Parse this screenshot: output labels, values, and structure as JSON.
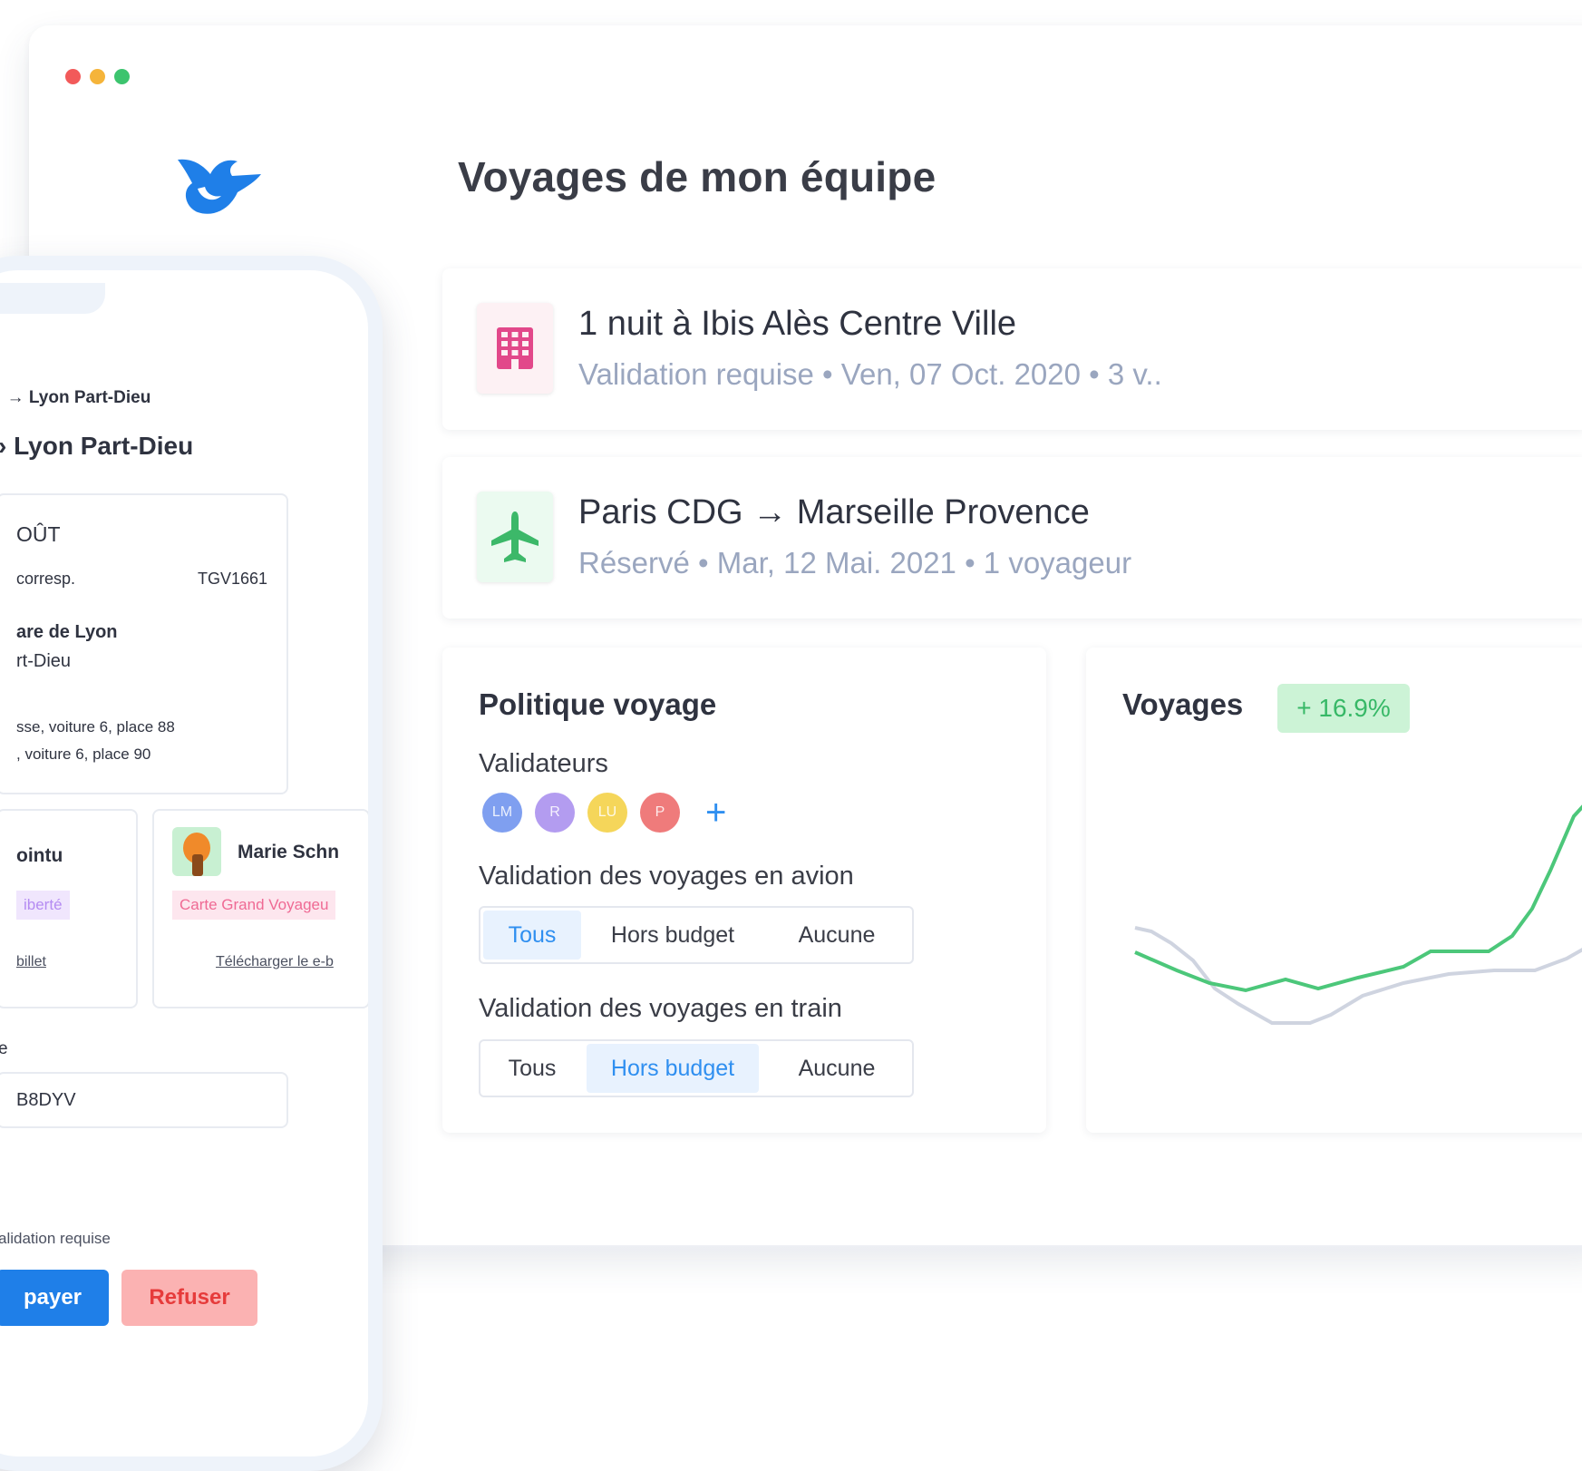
{
  "window_controls": {
    "close_color": "#f25a5a",
    "minimize_color": "#f5b43a",
    "maximize_color": "#3cc46e"
  },
  "header": {
    "title": "Voyages de mon équipe"
  },
  "trips": [
    {
      "title": "1 nuit à Ibis Alès Centre Ville",
      "subtitle": "Validation requise • Ven, 07 Oct. 2020 • 3 v..",
      "icon": "building-icon"
    },
    {
      "title": "Paris CDG → Marseille Provence",
      "subtitle": "Réservé • Mar, 12 Mai. 2021 • 1 voyageur",
      "icon": "plane-icon"
    }
  ],
  "policy": {
    "title": "Politique voyage",
    "validators_label": "Validateurs",
    "validators": [
      {
        "initials": "LM",
        "color": "#7f9ff0"
      },
      {
        "initials": "R",
        "color": "#b39cf0"
      },
      {
        "initials": "LU",
        "color": "#f5d65a"
      },
      {
        "initials": "P",
        "color": "#ef7b7b"
      }
    ],
    "add_label": "+",
    "plane_label": "Validation des voyages en avion",
    "plane_options": [
      "Tous",
      "Hors budget",
      "Aucune"
    ],
    "plane_selected": "Tous",
    "train_label": "Validation des voyages en train",
    "train_options": [
      "Tous",
      "Hors budget",
      "Aucune"
    ],
    "train_selected": "Hors budget"
  },
  "voyages_chart": {
    "title": "Voyages",
    "badge": "+ 16.9%",
    "colors": {
      "current": "#4cc77a",
      "previous": "#cfd4e0"
    }
  },
  "phone": {
    "route_small": "→ Lyon Part-Dieu",
    "route_big": "Lyon Part-Dieu",
    "date_partial": "OÛT",
    "corresp": "corresp.",
    "train_number": "TGV1661",
    "from_station": "are de Lyon",
    "to_station": "rt-Dieu",
    "seat_1": "sse, voiture 6, place 88",
    "seat_2": ", voiture 6, place 90",
    "passenger_1_name": "ointu",
    "passenger_1_card": "iberté",
    "passenger_1_link": "billet",
    "passenger_2_name": "Marie Schn",
    "passenger_2_card": "Carte Grand Voyageu",
    "passenger_2_link": "Télécharger le e-b",
    "ref_label": "e",
    "ref_value": "B8DYV",
    "status": "alidation requise",
    "approve_label": "payer",
    "refuse_label": "Refuser"
  }
}
